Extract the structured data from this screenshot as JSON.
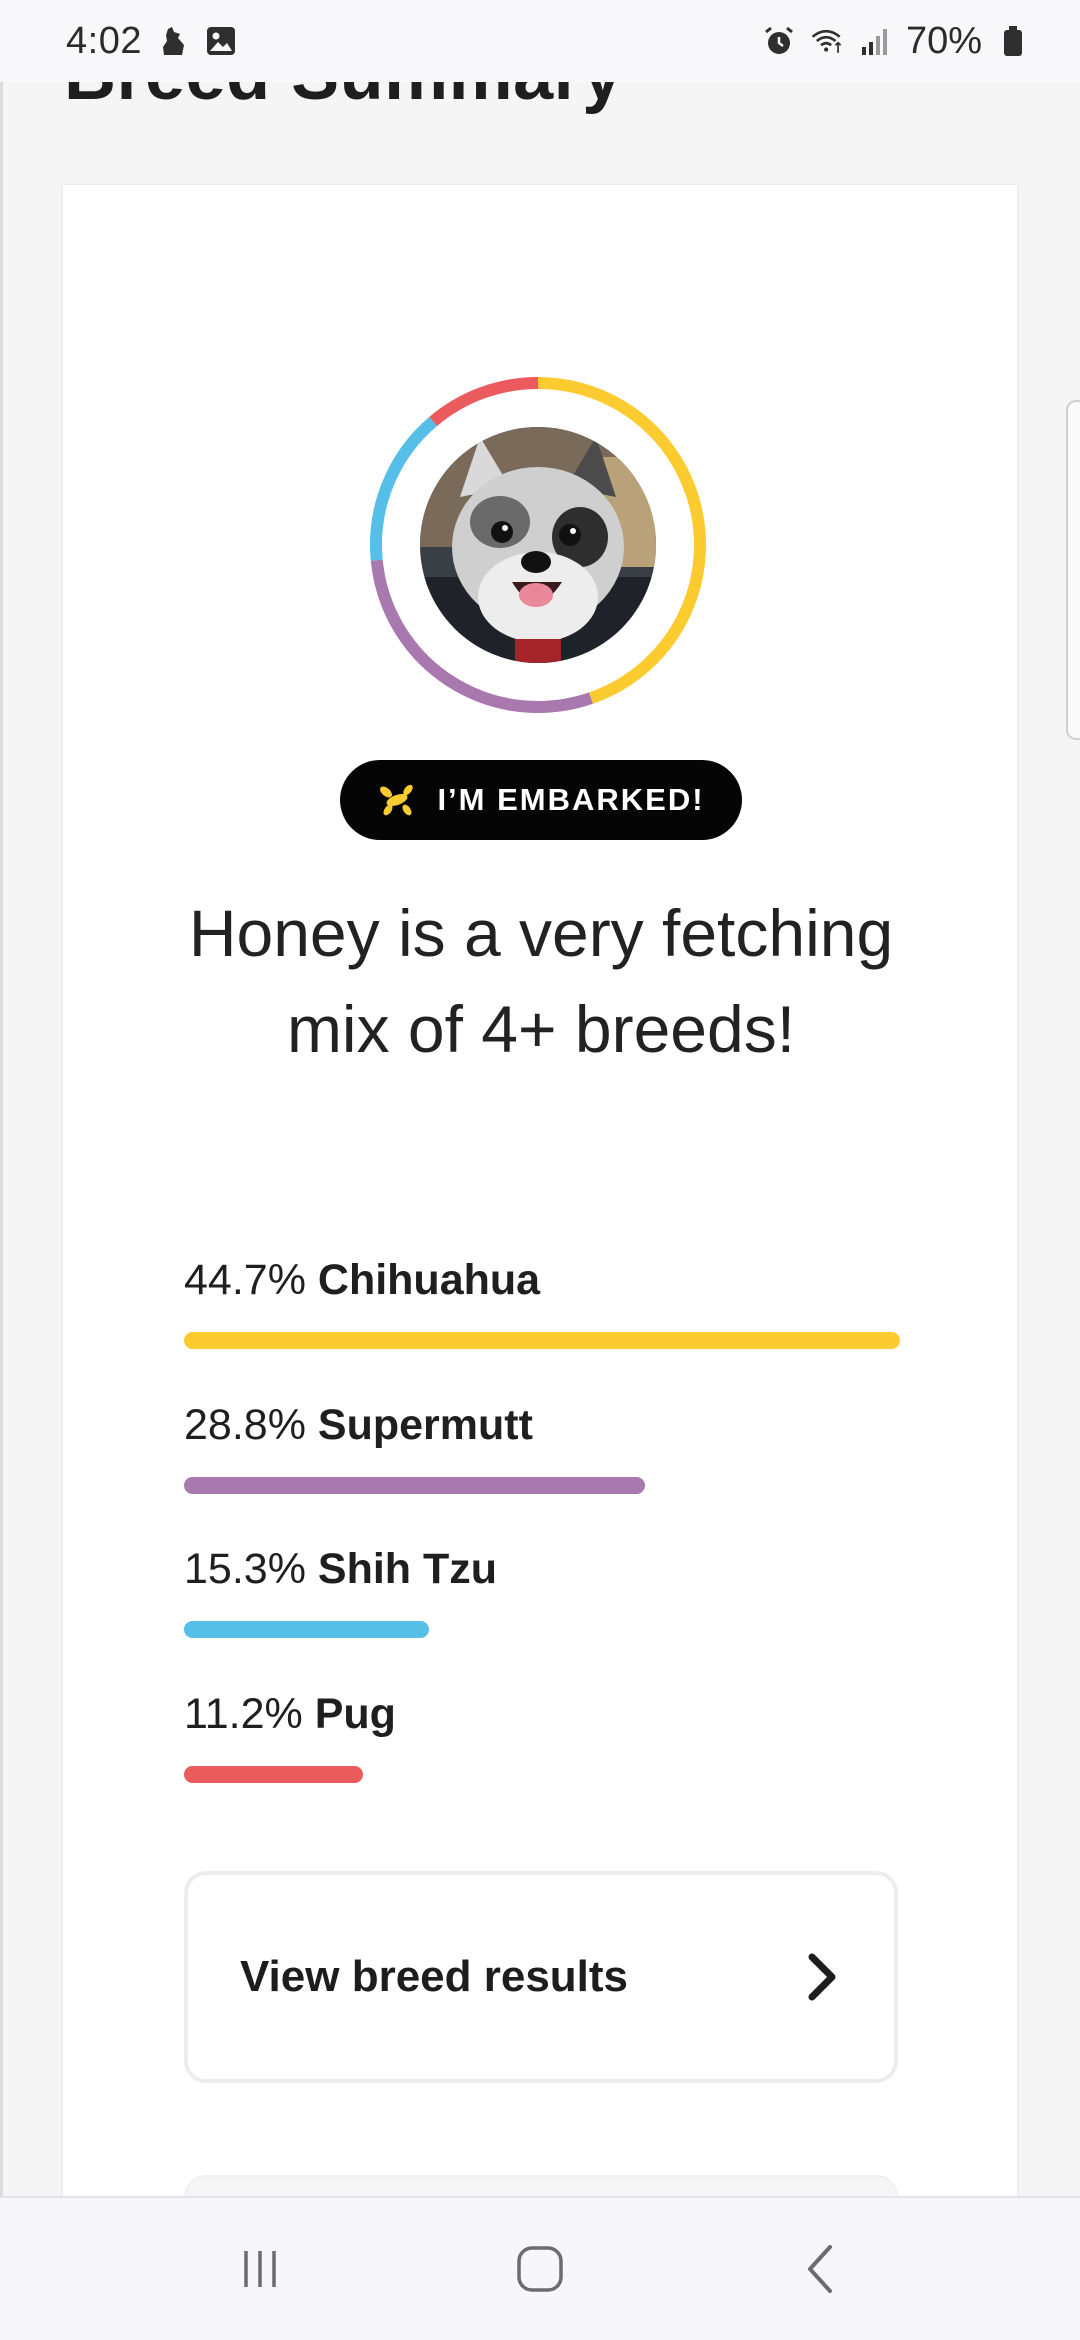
{
  "status_bar": {
    "time": "4:02",
    "battery_pct": "70%",
    "icons": [
      "dog-notification-icon",
      "gallery-icon",
      "alarm-icon",
      "wifi-icon",
      "signal-icon",
      "battery-icon"
    ]
  },
  "header": {
    "title": "Breed Summary"
  },
  "summary": {
    "badge_label": "I’M EMBARKED!",
    "headline": "Honey is a very fetching mix of 4+ breeds!",
    "breeds": [
      {
        "pct": "44.7%",
        "name": "Chihuahua",
        "fraction": 0.447,
        "color": "#FBCB30"
      },
      {
        "pct": "28.8%",
        "name": "Supermutt",
        "fraction": 0.288,
        "color": "#A878AE"
      },
      {
        "pct": "15.3%",
        "name": "Shih Tzu",
        "fraction": 0.153,
        "color": "#55BFE7"
      },
      {
        "pct": "11.2%",
        "name": "Pug",
        "fraction": 0.112,
        "color": "#EB5A5D"
      }
    ],
    "view_results_label": "View breed results"
  },
  "nav_bar": {
    "icons": [
      "recent-apps-icon",
      "home-icon",
      "back-icon"
    ]
  }
}
